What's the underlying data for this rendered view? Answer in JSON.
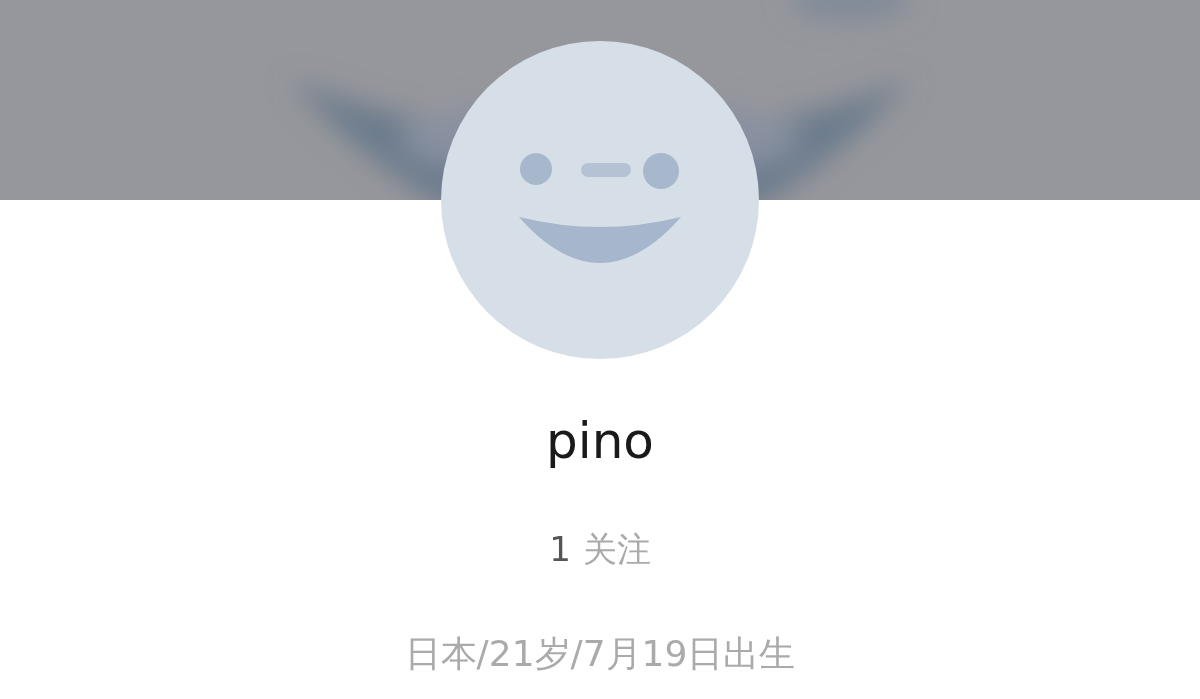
{
  "profile": {
    "name": "pino",
    "follow": {
      "count": "1",
      "label": "关注"
    },
    "info": "日本/21岁/7月19日出生"
  }
}
